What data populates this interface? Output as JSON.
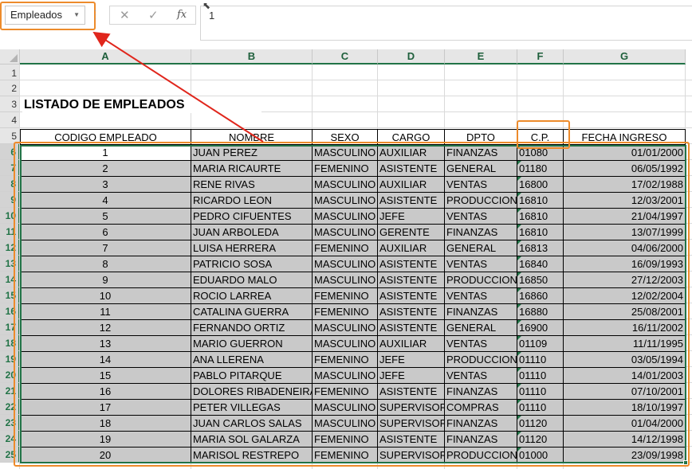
{
  "formula_bar": {
    "name_box": "Empleados",
    "formula_value": "1",
    "cancel_icon": "✕",
    "enter_icon": "✓",
    "fx_label": "fx"
  },
  "columns": [
    "A",
    "B",
    "C",
    "D",
    "E",
    "F",
    "G"
  ],
  "rows": [
    "1",
    "2",
    "3",
    "4",
    "5",
    "6",
    "7",
    "8",
    "9",
    "10",
    "11",
    "12",
    "13",
    "14",
    "15",
    "16",
    "17",
    "18",
    "19",
    "20",
    "21",
    "22",
    "23",
    "24",
    "25"
  ],
  "sheet": {
    "title": "LISTADO DE EMPLEADOS",
    "headers": [
      "CODIGO EMPLEADO",
      "NOMBRE",
      "SEXO",
      "CARGO",
      "DPTO",
      "C.P.",
      "FECHA INGRESO"
    ],
    "records": [
      [
        "1",
        "JUAN PEREZ",
        "MASCULINO",
        "AUXILIAR",
        "FINANZAS",
        "01080",
        "01/01/2000"
      ],
      [
        "2",
        "MARIA RICAURTE",
        "FEMENINO",
        "ASISTENTE",
        "GENERAL",
        "01180",
        "06/05/1992"
      ],
      [
        "3",
        "RENE RIVAS",
        "MASCULINO",
        "AUXILIAR",
        "VENTAS",
        "16800",
        "17/02/1988"
      ],
      [
        "4",
        "RICARDO LEON",
        "MASCULINO",
        "ASISTENTE",
        "PRODUCCION",
        "16810",
        "12/03/2001"
      ],
      [
        "5",
        "PEDRO CIFUENTES",
        "MASCULINO",
        "JEFE",
        "VENTAS",
        "16810",
        "21/04/1997"
      ],
      [
        "6",
        "JUAN ARBOLEDA",
        "MASCULINO",
        "GERENTE",
        "FINANZAS",
        "16810",
        "13/07/1999"
      ],
      [
        "7",
        "LUISA HERRERA",
        "FEMENINO",
        "AUXILIAR",
        "GENERAL",
        "16813",
        "04/06/2000"
      ],
      [
        "8",
        "PATRICIO SOSA",
        "MASCULINO",
        "ASISTENTE",
        "VENTAS",
        "16840",
        "16/09/1993"
      ],
      [
        "9",
        "EDUARDO MALO",
        "MASCULINO",
        "ASISTENTE",
        "PRODUCCION",
        "16850",
        "27/12/2003"
      ],
      [
        "10",
        "ROCIO LARREA",
        "FEMENINO",
        "ASISTENTE",
        "VENTAS",
        "16860",
        "12/02/2004"
      ],
      [
        "11",
        "CATALINA GUERRA",
        "FEMENINO",
        "ASISTENTE",
        "FINANZAS",
        "16880",
        "25/08/2001"
      ],
      [
        "12",
        "FERNANDO ORTIZ",
        "MASCULINO",
        "ASISTENTE",
        "GENERAL",
        "16900",
        "16/11/2002"
      ],
      [
        "13",
        "MARIO GUERRON",
        "MASCULINO",
        "AUXILIAR",
        "VENTAS",
        "01109",
        "11/11/1995"
      ],
      [
        "14",
        "ANA LLERENA",
        "FEMENINO",
        "JEFE",
        "PRODUCCION",
        "01110",
        "03/05/1994"
      ],
      [
        "15",
        "PABLO PITARQUE",
        "MASCULINO",
        "JEFE",
        "VENTAS",
        "01110",
        "14/01/2003"
      ],
      [
        "16",
        "DOLORES RIBADENEIRA",
        "FEMENINO",
        "ASISTENTE",
        "FINANZAS",
        "01110",
        "07/10/2001"
      ],
      [
        "17",
        "PETER VILLEGAS",
        "MASCULINO",
        "SUPERVISOR",
        "COMPRAS",
        "01110",
        "18/10/1997"
      ],
      [
        "18",
        "JUAN CARLOS SALAS",
        "MASCULINO",
        "SUPERVISOR",
        "FINANZAS",
        "01120",
        "01/04/2000"
      ],
      [
        "19",
        "MARIA SOL GALARZA",
        "FEMENINO",
        "ASISTENTE",
        "FINANZAS",
        "01120",
        "14/12/1998"
      ],
      [
        "20",
        "MARISOL RESTREPO",
        "FEMENINO",
        "SUPERVISOR",
        "PRODUCCION",
        "01000",
        "23/09/1998"
      ]
    ]
  },
  "colors": {
    "selection": "#217346",
    "annotation": "#ed8b2b",
    "arrow": "#e0261c",
    "range_fill": "#c9c9c9"
  }
}
